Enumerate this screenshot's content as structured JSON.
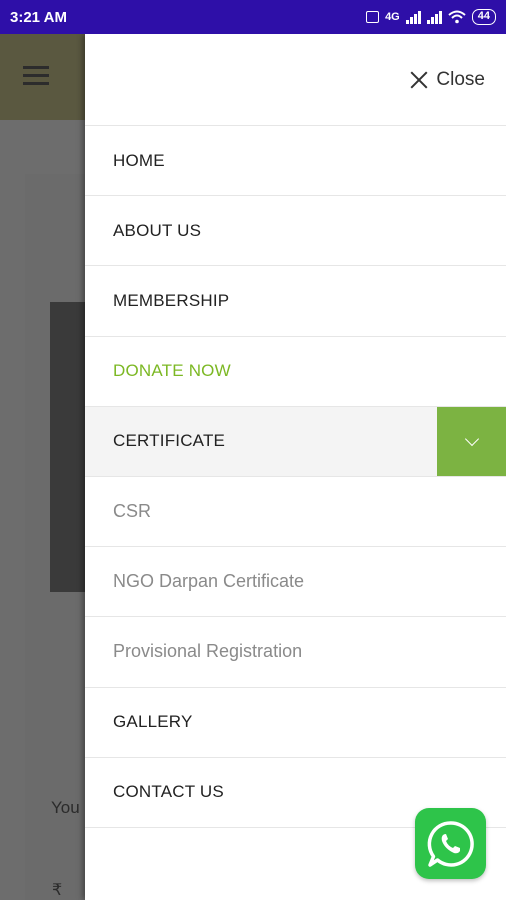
{
  "status_bar": {
    "time": "3:21 AM",
    "network": "4G",
    "battery": "44"
  },
  "background": {
    "partial_text": "You",
    "currency_symbol": "₹"
  },
  "drawer": {
    "close_label": "Close",
    "items": [
      {
        "label": "HOME"
      },
      {
        "label": "ABOUT US"
      },
      {
        "label": "MEMBERSHIP"
      },
      {
        "label": "DONATE NOW"
      },
      {
        "label": "CERTIFICATE"
      },
      {
        "label": "CSR"
      },
      {
        "label": "NGO Darpan Certificate"
      },
      {
        "label": "Provisional Registration"
      },
      {
        "label": "GALLERY"
      },
      {
        "label": "CONTACT US"
      }
    ]
  },
  "colors": {
    "accent_green": "#7cb342",
    "donate_green": "#7cb824",
    "status_bar": "#2e0fa8",
    "whatsapp": "#2ec44a"
  },
  "icons": [
    "hamburger-icon",
    "close-icon",
    "chevron-down-icon",
    "whatsapp-icon"
  ]
}
